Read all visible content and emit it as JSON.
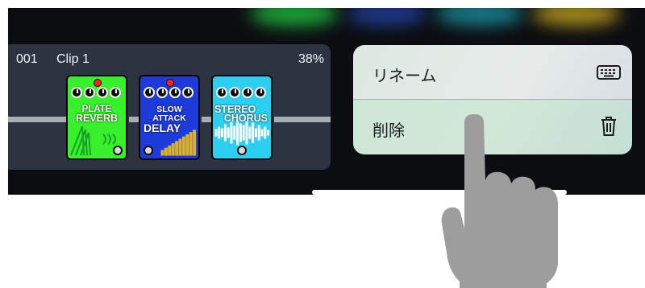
{
  "clip": {
    "number": "001",
    "name": "Clip 1",
    "percent": "38%"
  },
  "pedals": [
    {
      "name_line1": "PLATE",
      "name_line2": "REVERB",
      "color": "#38f02b",
      "deco_color": "#1a9d2a"
    },
    {
      "name_line1": "SLOW ATTACK",
      "name_line2": "DELAY",
      "color": "#1c3bd8",
      "deco_color": "#d9b12a"
    },
    {
      "name_line1": "STEREO",
      "name_line2": "CHORUS",
      "color": "#2ccff0",
      "deco_color": "#ffffff"
    }
  ],
  "context_menu": {
    "rename_label": "リネーム",
    "rename_icon": "keyboard-icon",
    "delete_label": "削除",
    "delete_icon": "trash-icon"
  },
  "colors": {
    "background": "#0c0d11",
    "clip_card": "#2b3440",
    "menu_bg": "#e2e9e6"
  }
}
